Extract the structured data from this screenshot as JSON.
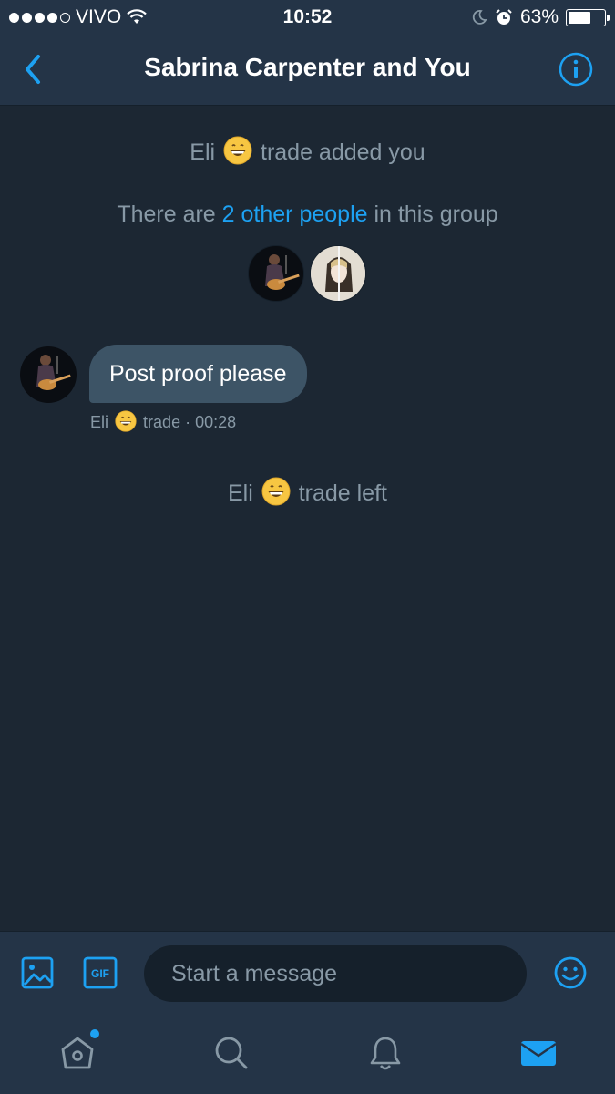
{
  "status_bar": {
    "carrier": "VIVO",
    "time": "10:52",
    "battery_percent": "63%",
    "battery_level": 0.63,
    "signal_bars_filled": 4,
    "signal_bars_total": 5
  },
  "header": {
    "title": "Sabrina Carpenter and You",
    "back_icon": "chevron-left-icon",
    "info_icon": "info-icon"
  },
  "conversation": {
    "added_event": {
      "name_before": "Eli",
      "emoji": "grinning-face",
      "name_after": "trade added you"
    },
    "group_info": {
      "prefix": "There are ",
      "link": "2 other people",
      "suffix": " in this group"
    },
    "message": {
      "text": "Post proof please",
      "sender_before": "Eli",
      "sender_after": "trade",
      "separator": "·",
      "time": "00:28"
    },
    "left_event": {
      "name_before": "Eli",
      "name_after": "trade left"
    }
  },
  "composer": {
    "placeholder": "Start a message",
    "gif_label": "GIF"
  },
  "tab_bar": {
    "tabs": [
      "home-icon",
      "search-icon",
      "notifications-icon",
      "messages-icon"
    ],
    "active": "messages-icon"
  },
  "colors": {
    "background": "#1c2733",
    "bars": "#243447",
    "accent": "#1da1f2",
    "bubble": "#3d5466",
    "muted_text": "#8899a6"
  }
}
